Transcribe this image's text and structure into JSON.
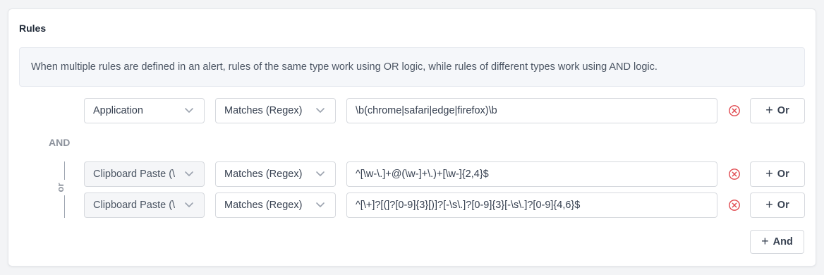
{
  "section": {
    "title": "Rules",
    "info_text": "When multiple rules are defined in an alert, rules of the same type work using OR logic, while rules of different types work using AND logic."
  },
  "groups": [
    {
      "rules": [
        {
          "type": "Application",
          "operator": "Matches (Regex)",
          "value": "\\b(chrome|safari|edge|firefox)\\b",
          "type_disabled": false
        }
      ]
    },
    {
      "rules": [
        {
          "type": "Clipboard Paste (\\",
          "operator": "Matches (Regex)",
          "value": "^[\\w-\\.]+@(\\w-]+\\.)+[\\w-]{2,4}$",
          "type_disabled": true
        },
        {
          "type": "Clipboard Paste (\\",
          "operator": "Matches (Regex)",
          "value": "^[\\+]?[(]?[0-9]{3}[)]?[-\\s\\.]?[0-9]{3}[-\\s\\.]?[0-9]{4,6}$",
          "type_disabled": true
        }
      ]
    }
  ],
  "labels": {
    "and_connector": "AND",
    "or_connector": "or",
    "or_button": "Or",
    "and_button": "And"
  },
  "colors": {
    "remove_icon": "#e0484e",
    "connector_text": "#8c929c",
    "info_background": "#f5f7fa"
  },
  "icons": {
    "remove": "circle-x-icon",
    "dropdown": "chevron-down-icon",
    "add": "plus-icon"
  }
}
